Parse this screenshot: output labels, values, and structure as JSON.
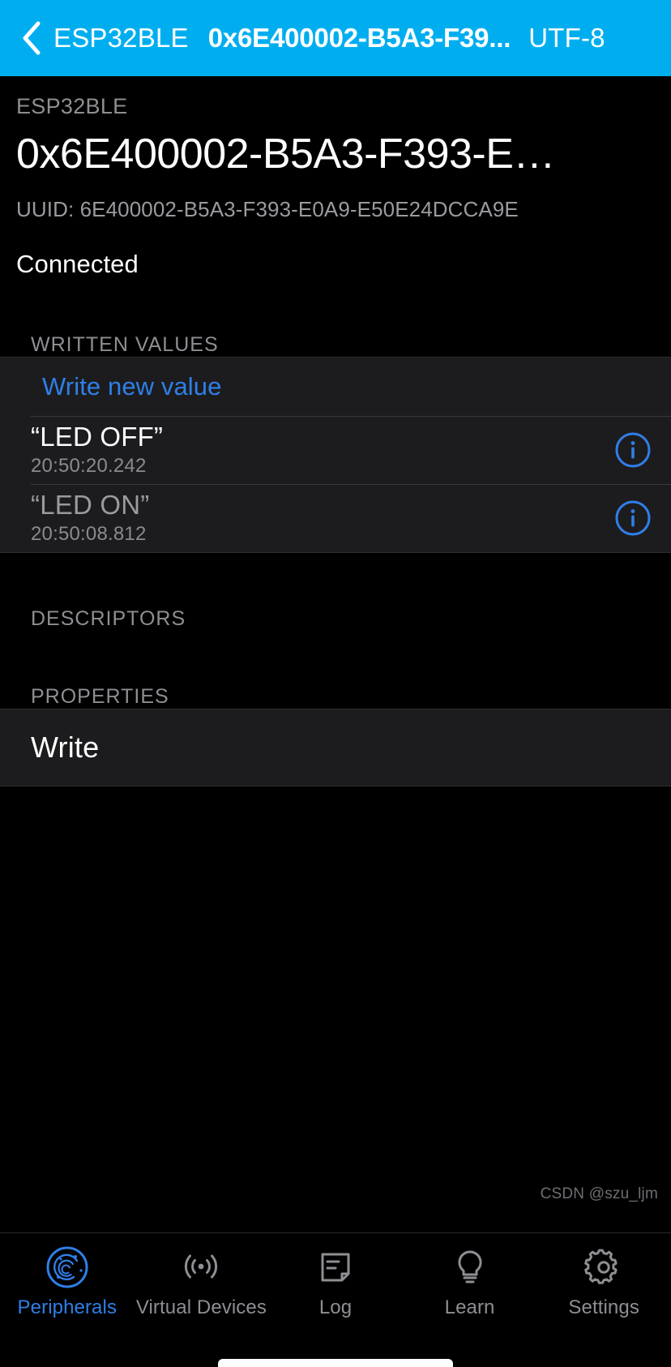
{
  "navbar": {
    "back_label": "ESP32BLE",
    "title": "0x6E400002-B5A3-F39...",
    "encoding": "UTF-8",
    "background_color": "#00AEEF",
    "back_icon": "chevron-left-icon"
  },
  "detail": {
    "device_name": "ESP32BLE",
    "characteristic_title": "0x6E400002-B5A3-F393-E…",
    "uuid_line": "UUID: 6E400002-B5A3-F393-E0A9-E50E24DCCA9E",
    "connection_status": "Connected"
  },
  "sections": {
    "written_values_header": "WRITTEN VALUES",
    "descriptors_header": "DESCRIPTORS",
    "properties_header": "PROPERTIES"
  },
  "written_values": {
    "write_new_label": "Write new value",
    "write_new_color": "#2f7fe8",
    "items": [
      {
        "value": "“LED OFF”",
        "timestamp": "20:50:20.242",
        "info_icon": "info-circle-icon"
      },
      {
        "value": "“LED ON”",
        "timestamp": "20:50:08.812",
        "info_icon": "info-circle-icon"
      }
    ]
  },
  "properties": {
    "items": [
      {
        "label": "Write"
      }
    ]
  },
  "tabbar": {
    "active_color": "#2f7fe8",
    "inactive_color": "#8e8e93",
    "tabs": [
      {
        "label": "Peripherals",
        "icon": "radar-peripherals-icon",
        "active": true
      },
      {
        "label": "Virtual Devices",
        "icon": "broadcast-waves-icon",
        "active": false
      },
      {
        "label": "Log",
        "icon": "note-lines-icon",
        "active": false
      },
      {
        "label": "Learn",
        "icon": "lightbulb-icon",
        "active": false
      },
      {
        "label": "Settings",
        "icon": "gear-icon",
        "active": false
      }
    ]
  },
  "watermark": {
    "text": "CSDN @szu_ljm"
  }
}
